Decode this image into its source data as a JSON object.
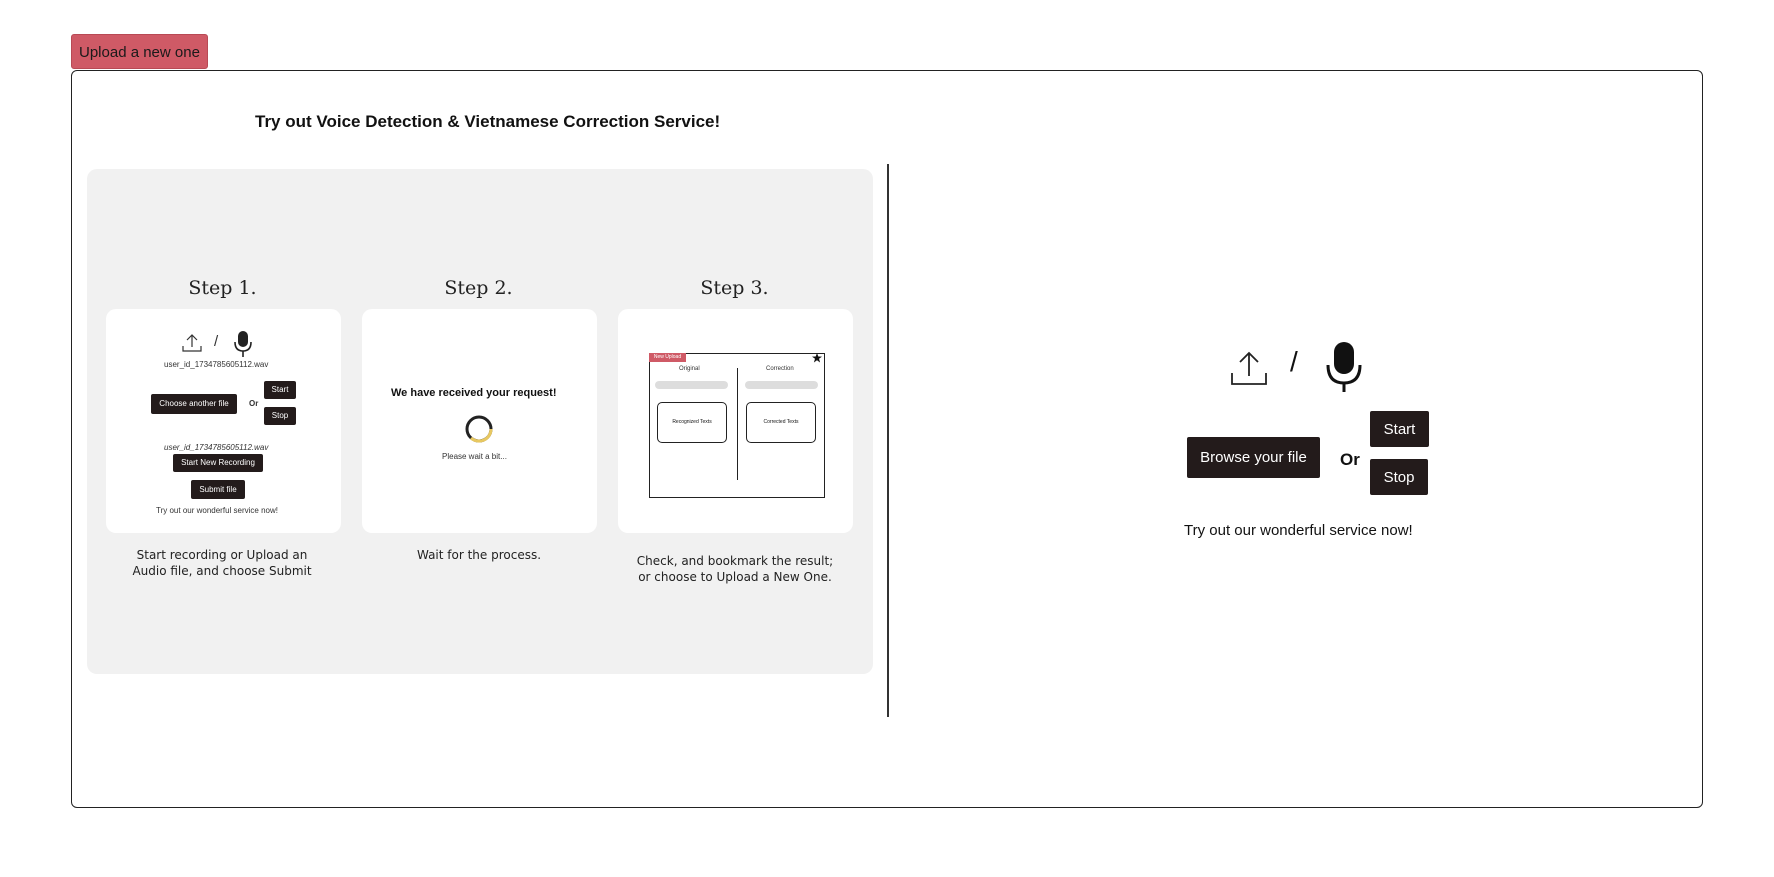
{
  "upload_new_button": "Upload a new one",
  "panel_title": "Try out Voice Detection & Vietnamese Correction Service!",
  "tutorial": {
    "steps": [
      {
        "heading": "Step 1.",
        "caption_line1": "Start recording or Upload an",
        "caption_line2": "Audio file, and choose Submit"
      },
      {
        "heading": "Step 2.",
        "caption_line1": "Wait for the process.",
        "caption_line2": ""
      },
      {
        "heading": "Step 3.",
        "caption_line1": "Check, and bookmark the result;",
        "caption_line2": "or choose to Upload a New One."
      }
    ],
    "step1_card": {
      "separator": "/",
      "filename": "user_id_1734785605112.wav",
      "choose_another": "Choose another file",
      "or": "Or",
      "start": "Start",
      "stop": "Stop",
      "filename2": "user_id_1734785605112.wav",
      "start_new_recording": "Start New Recording",
      "submit_file": "Submit file",
      "try_text": "Try out our wonderful service now!"
    },
    "step2_card": {
      "received": "We have received your request!",
      "wait": "Please wait a bit..."
    },
    "step3_card": {
      "new_upload": "New Upload",
      "original": "Original",
      "correction": "Correction",
      "recognized": "Recognized Texts",
      "corrected": "Corrected Texts"
    }
  },
  "uploader": {
    "separator": "/",
    "browse_button": "Browse your file",
    "or": "Or",
    "start_button": "Start",
    "stop_button": "Stop",
    "try_text": "Try out our wonderful service now!"
  }
}
